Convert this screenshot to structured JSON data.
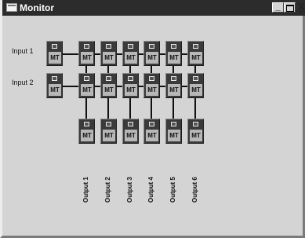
{
  "window": {
    "title": "Monitor"
  },
  "titlebar_buttons": {
    "minimize": "_",
    "close": "X"
  },
  "inputs": [
    "Input 1",
    "Input 2"
  ],
  "module_label": "MT",
  "outputs": [
    "Output 1",
    "Output 2",
    "Output 3",
    "Output 4",
    "Output 5",
    "Output 6"
  ]
}
